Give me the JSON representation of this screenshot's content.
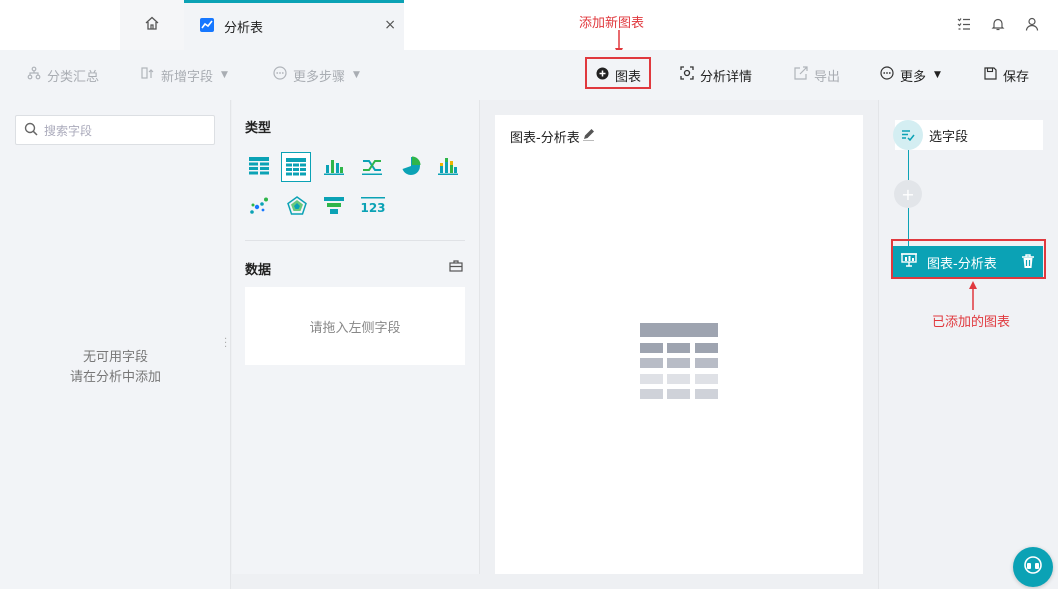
{
  "tabs": {
    "home_icon": "home-icon",
    "active": {
      "label": "分析表",
      "icon": "line-chart-icon",
      "close": "×"
    }
  },
  "top_icons": [
    "task-list-icon",
    "bell-icon",
    "user-icon"
  ],
  "toolbar": {
    "group_summary": "分类汇总",
    "add_field": "新增字段",
    "more_steps": "更多步骤",
    "add_chart": "图表",
    "analysis_detail": "分析详情",
    "export": "导出",
    "more": "更多",
    "save": "保存"
  },
  "annotations": {
    "add_new_chart": "添加新图表",
    "added_chart": "已添加的图表"
  },
  "fields_panel": {
    "search_placeholder": "搜索字段",
    "empty_line1": "无可用字段",
    "empty_line2": "请在分析中添加"
  },
  "type_panel": {
    "type_title": "类型",
    "chart_types": [
      "table-icon",
      "detail-table-icon",
      "bar-chart-icon",
      "cross-line-chart-icon",
      "pie-chart-icon",
      "stacked-bar-chart-icon",
      "scatter-chart-icon",
      "radar-chart-icon",
      "funnel-chart-icon",
      "number-card-icon"
    ],
    "selected_type_index": 1,
    "data_title": "数据",
    "drop_hint": "请拖入左侧字段"
  },
  "canvas": {
    "title": "图表-分析表"
  },
  "steps_panel": {
    "select_fields": "选字段",
    "chart_step": "图表-分析表"
  },
  "colors": {
    "accent": "#0ba2b5",
    "annotation_red": "#e0393e"
  }
}
